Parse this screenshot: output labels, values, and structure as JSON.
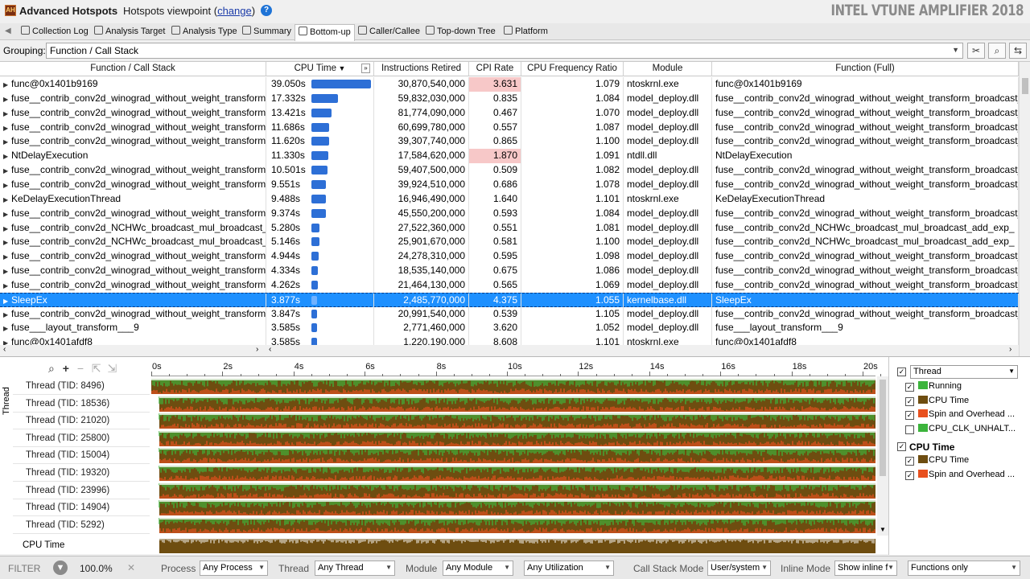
{
  "titlebar": {
    "app_title": "Advanced Hotspots",
    "viewpoint_prefix": "Hotspots viewpoint (",
    "viewpoint_link": "change",
    "viewpoint_suffix": ")",
    "help": "?",
    "product": "INTEL VTUNE AMPLIFIER 2018"
  },
  "tabs": [
    {
      "label": "Collection Log",
      "icon": "collection-log-icon"
    },
    {
      "label": "Analysis Target",
      "icon": "target-icon"
    },
    {
      "label": "Analysis Type",
      "icon": "analysis-type-icon"
    },
    {
      "label": "Summary",
      "icon": "summary-icon"
    },
    {
      "label": "Bottom-up",
      "icon": "bottom-up-icon",
      "active": true
    },
    {
      "label": "Caller/Callee",
      "icon": "caller-callee-icon"
    },
    {
      "label": "Top-down Tree",
      "icon": "top-down-icon"
    },
    {
      "label": "Platform",
      "icon": "platform-icon"
    }
  ],
  "grouping": {
    "label": "Grouping:",
    "value": "Function / Call Stack"
  },
  "grid": {
    "columns": [
      "Function / Call Stack",
      "CPU Time",
      "Instructions Retired",
      "CPI Rate",
      "CPU Frequency Ratio",
      "Module",
      "Function (Full)"
    ],
    "max_cpu": 39.05,
    "rows": [
      {
        "fn": "func@0x1401b9169",
        "cpu": "39.050s",
        "cpu_val": 39.05,
        "instr": "30,870,540,000",
        "cpi": "3.631",
        "cpi_high": true,
        "freq": "1.079",
        "module": "ntoskrnl.exe",
        "full": "func@0x1401b9169"
      },
      {
        "fn": "fuse__contrib_conv2d_winograd_without_weight_transform_",
        "cpu": "17.332s",
        "cpu_val": 17.332,
        "instr": "59,832,030,000",
        "cpi": "0.835",
        "freq": "1.084",
        "module": "model_deploy.dll",
        "full": "fuse__contrib_conv2d_winograd_without_weight_transform_broadcast_"
      },
      {
        "fn": "fuse__contrib_conv2d_winograd_without_weight_transform_",
        "cpu": "13.421s",
        "cpu_val": 13.421,
        "instr": "81,774,090,000",
        "cpi": "0.467",
        "freq": "1.070",
        "module": "model_deploy.dll",
        "full": "fuse__contrib_conv2d_winograd_without_weight_transform_broadcast_"
      },
      {
        "fn": "fuse__contrib_conv2d_winograd_without_weight_transform_",
        "cpu": "11.686s",
        "cpu_val": 11.686,
        "instr": "60,699,780,000",
        "cpi": "0.557",
        "freq": "1.087",
        "module": "model_deploy.dll",
        "full": "fuse__contrib_conv2d_winograd_without_weight_transform_broadcast_"
      },
      {
        "fn": "fuse__contrib_conv2d_winograd_without_weight_transform_",
        "cpu": "11.620s",
        "cpu_val": 11.62,
        "instr": "39,307,740,000",
        "cpi": "0.865",
        "freq": "1.100",
        "module": "model_deploy.dll",
        "full": "fuse__contrib_conv2d_winograd_without_weight_transform_broadcast_"
      },
      {
        "fn": "NtDelayExecution",
        "cpu": "11.330s",
        "cpu_val": 11.33,
        "instr": "17,584,620,000",
        "cpi": "1.870",
        "cpi_high": true,
        "freq": "1.091",
        "module": "ntdll.dll",
        "full": "NtDelayExecution"
      },
      {
        "fn": "fuse__contrib_conv2d_winograd_without_weight_transform_",
        "cpu": "10.501s",
        "cpu_val": 10.501,
        "instr": "59,407,500,000",
        "cpi": "0.509",
        "freq": "1.082",
        "module": "model_deploy.dll",
        "full": "fuse__contrib_conv2d_winograd_without_weight_transform_broadcast_"
      },
      {
        "fn": "fuse__contrib_conv2d_winograd_without_weight_transform_",
        "cpu": "9.551s",
        "cpu_val": 9.551,
        "instr": "39,924,510,000",
        "cpi": "0.686",
        "freq": "1.078",
        "module": "model_deploy.dll",
        "full": "fuse__contrib_conv2d_winograd_without_weight_transform_broadcast_"
      },
      {
        "fn": "KeDelayExecutionThread",
        "cpu": "9.488s",
        "cpu_val": 9.488,
        "instr": "16,946,490,000",
        "cpi": "1.640",
        "freq": "1.101",
        "module": "ntoskrnl.exe",
        "full": "KeDelayExecutionThread"
      },
      {
        "fn": "fuse__contrib_conv2d_winograd_without_weight_transform_",
        "cpu": "9.374s",
        "cpu_val": 9.374,
        "instr": "45,550,200,000",
        "cpi": "0.593",
        "freq": "1.084",
        "module": "model_deploy.dll",
        "full": "fuse__contrib_conv2d_winograd_without_weight_transform_broadcast_"
      },
      {
        "fn": "fuse__contrib_conv2d_NCHWc_broadcast_mul_broadcast_",
        "cpu": "5.280s",
        "cpu_val": 5.28,
        "instr": "27,522,360,000",
        "cpi": "0.551",
        "freq": "1.081",
        "module": "model_deploy.dll",
        "full": "fuse__contrib_conv2d_NCHWc_broadcast_mul_broadcast_add_exp_"
      },
      {
        "fn": "fuse__contrib_conv2d_NCHWc_broadcast_mul_broadcast_",
        "cpu": "5.146s",
        "cpu_val": 5.146,
        "instr": "25,901,670,000",
        "cpi": "0.581",
        "freq": "1.100",
        "module": "model_deploy.dll",
        "full": "fuse__contrib_conv2d_NCHWc_broadcast_mul_broadcast_add_exp_"
      },
      {
        "fn": "fuse__contrib_conv2d_winograd_without_weight_transform_",
        "cpu": "4.944s",
        "cpu_val": 4.944,
        "instr": "24,278,310,000",
        "cpi": "0.595",
        "freq": "1.098",
        "module": "model_deploy.dll",
        "full": "fuse__contrib_conv2d_winograd_without_weight_transform_broadcast_"
      },
      {
        "fn": "fuse__contrib_conv2d_winograd_without_weight_transform_",
        "cpu": "4.334s",
        "cpu_val": 4.334,
        "instr": "18,535,140,000",
        "cpi": "0.675",
        "freq": "1.086",
        "module": "model_deploy.dll",
        "full": "fuse__contrib_conv2d_winograd_without_weight_transform_broadcast_"
      },
      {
        "fn": "fuse__contrib_conv2d_winograd_without_weight_transform_",
        "cpu": "4.262s",
        "cpu_val": 4.262,
        "instr": "21,464,130,000",
        "cpi": "0.565",
        "freq": "1.069",
        "module": "model_deploy.dll",
        "full": "fuse__contrib_conv2d_winograd_without_weight_transform_broadcast_"
      },
      {
        "fn": "SleepEx",
        "cpu": "3.877s",
        "cpu_val": 3.877,
        "instr": "2,485,770,000",
        "cpi": "4.375",
        "cpi_high": true,
        "freq": "1.055",
        "module": "kernelbase.dll",
        "full": "SleepEx",
        "selected": true
      },
      {
        "fn": "fuse__contrib_conv2d_winograd_without_weight_transform_",
        "cpu": "3.847s",
        "cpu_val": 3.847,
        "instr": "20,991,540,000",
        "cpi": "0.539",
        "freq": "1.105",
        "module": "model_deploy.dll",
        "full": "fuse__contrib_conv2d_winograd_without_weight_transform_broadcast_"
      },
      {
        "fn": "fuse___layout_transform___9",
        "cpu": "3.585s",
        "cpu_val": 3.585,
        "instr": "2,771,460,000",
        "cpi": "3.620",
        "freq": "1.052",
        "module": "model_deploy.dll",
        "full": "fuse___layout_transform___9"
      },
      {
        "fn": "func@0x1401afdf8",
        "cpu": "3.585s",
        "cpu_val": 3.585,
        "instr": "1,220,190,000",
        "cpi": "8.608",
        "freq": "1.101",
        "module": "ntoskrnl.exe",
        "full": "func@0x1401afdf8"
      }
    ]
  },
  "timeline": {
    "axis_label": "Thread",
    "ticks": [
      "0s",
      "2s",
      "4s",
      "6s",
      "8s",
      "10s",
      "12s",
      "14s",
      "16s",
      "18s",
      "20s"
    ],
    "threads": [
      "Thread (TID: 8496)",
      "Thread (TID: 18536)",
      "Thread (TID: 21020)",
      "Thread (TID: 25800)",
      "Thread (TID: 15004)",
      "Thread (TID: 19320)",
      "Thread (TID: 23996)",
      "Thread (TID: 14904)",
      "Thread (TID: 5292)"
    ],
    "cpu_time_label": "CPU Time"
  },
  "legend": {
    "select": "Thread",
    "items": [
      {
        "label": "Running",
        "checked": true,
        "color": "#3cb43c"
      },
      {
        "label": "CPU Time",
        "checked": true,
        "color": "#6e4d10"
      },
      {
        "label": "Spin and Overhead ...",
        "checked": true,
        "color": "#e8501e"
      },
      {
        "label": "CPU_CLK_UNHALT...",
        "checked": false,
        "color": "#3cb43c"
      }
    ],
    "section2": "CPU Time",
    "items2": [
      {
        "label": "CPU Time",
        "checked": true,
        "color": "#6e4d10"
      },
      {
        "label": "Spin and Overhead ...",
        "checked": true,
        "color": "#e8501e"
      }
    ]
  },
  "filterbar": {
    "filter_label": "FILTER",
    "percent": "100.0%",
    "process_label": "Process",
    "process_value": "Any Process",
    "thread_label": "Thread",
    "thread_value": "Any Thread",
    "module_label": "Module",
    "module_value": "Any Module",
    "utilization_value": "Any Utilization",
    "callstack_label": "Call Stack Mode",
    "callstack_value": "User/system",
    "inline_label": "Inline Mode",
    "inline_value": "Show inline f",
    "functions_value": "Functions only"
  }
}
